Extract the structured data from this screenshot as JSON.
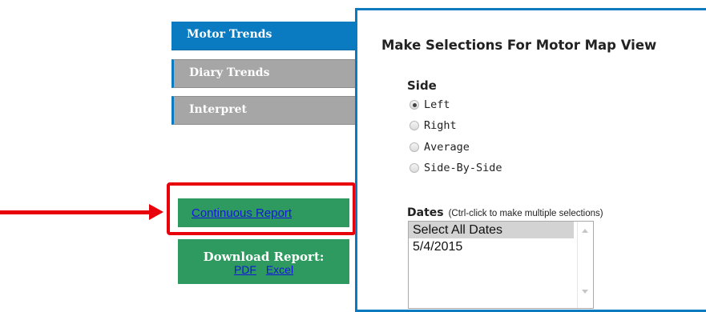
{
  "nav": {
    "tabs": [
      {
        "label": "Motor Trends"
      },
      {
        "label": "Diary Trends"
      },
      {
        "label": "Interpret"
      }
    ]
  },
  "reports": {
    "continuous_label": "Continuous Report",
    "download_title": "Download Report:",
    "pdf_label": "PDF",
    "excel_label": "Excel"
  },
  "panel": {
    "title": "Make Selections For Motor Map View",
    "side": {
      "label": "Side",
      "options": [
        "Left",
        "Right",
        "Average",
        "Side-By-Side"
      ],
      "selected": "Left"
    },
    "dates": {
      "label": "Dates",
      "hint": "(Ctrl-click to make multiple selections)",
      "options": [
        "Select All Dates",
        "5/4/2015"
      ],
      "selected": "Select All Dates"
    }
  },
  "colors": {
    "active_tab": "#0a7bc1",
    "inactive_tab": "#a6a6a6",
    "green_button": "#2f9a5f",
    "annotation_red": "#e8000a"
  }
}
